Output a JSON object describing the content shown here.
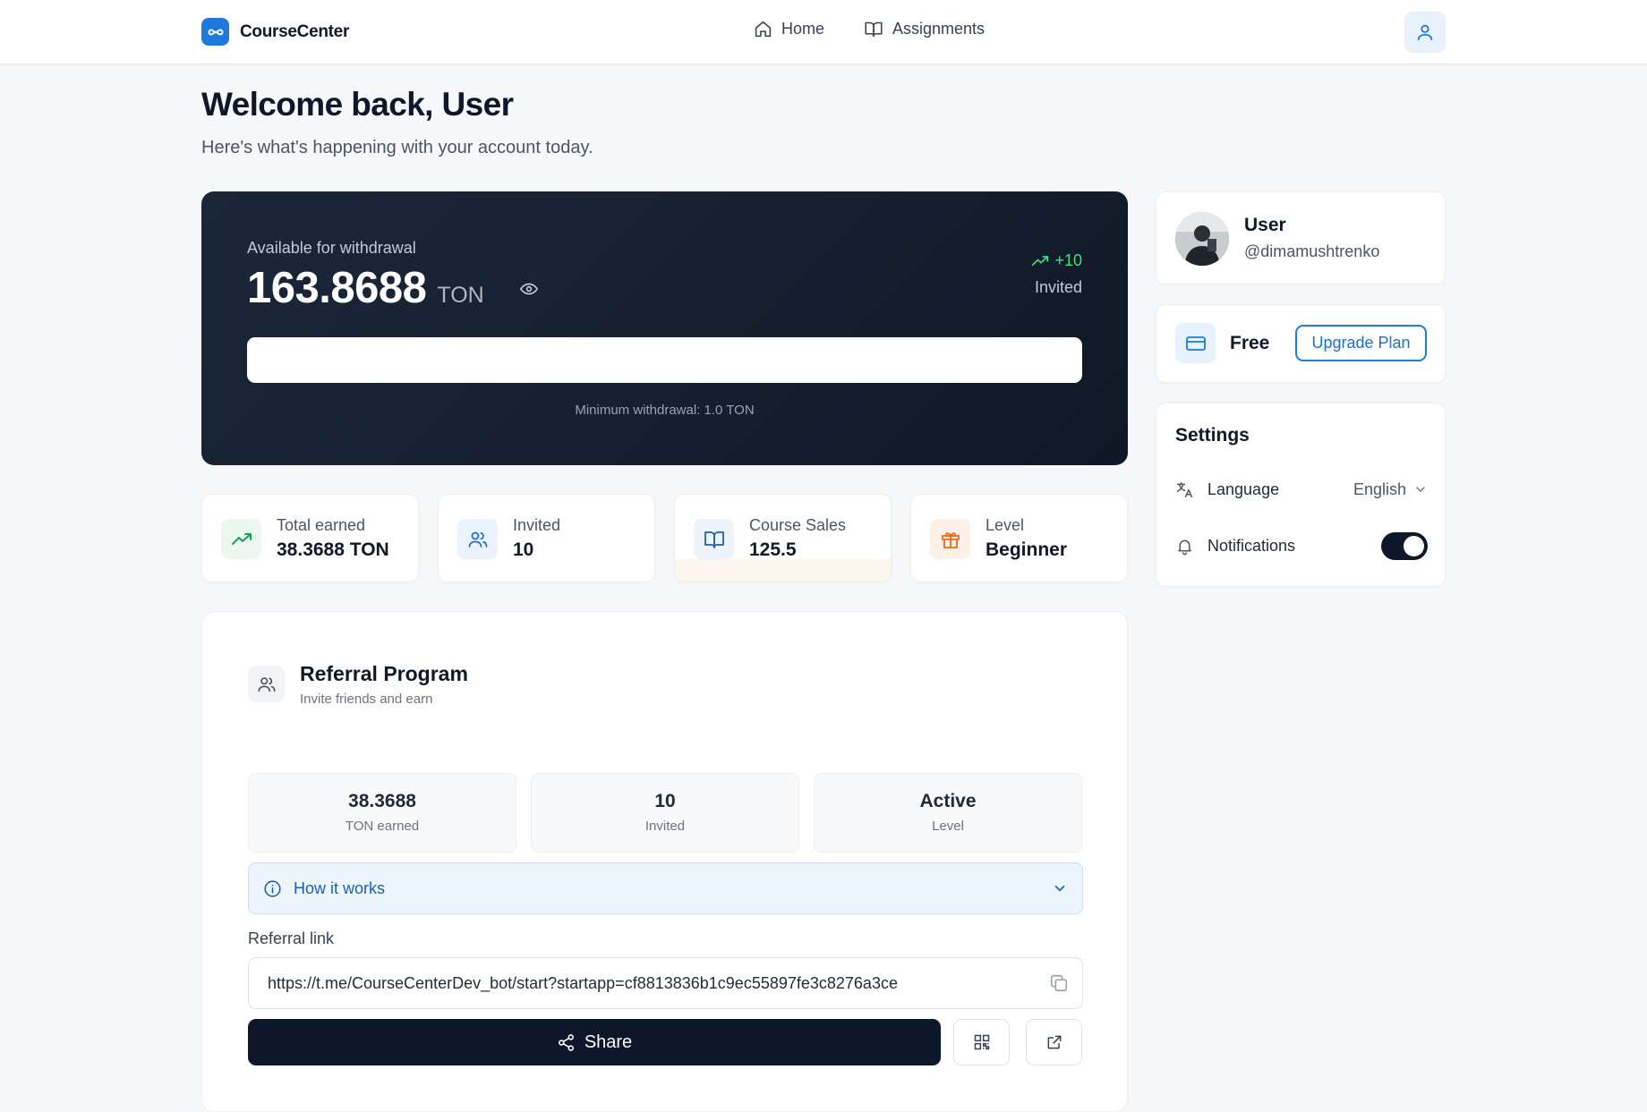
{
  "header": {
    "brand": "CourseCenter",
    "nav": [
      {
        "label": "Home",
        "icon": "home-icon"
      },
      {
        "label": "Assignments",
        "icon": "book-open-icon"
      }
    ],
    "user_icon": "user-icon"
  },
  "welcome": {
    "title": "Welcome back, User",
    "subtitle": "Here's what's happening with your account today."
  },
  "balance": {
    "label": "Available for withdrawal",
    "amount": "163.8688",
    "unit": "TON",
    "trend": "+10",
    "trend_label": "Invited",
    "min_note": "Minimum withdrawal: 1.0 TON"
  },
  "stats": [
    {
      "label": "Total earned",
      "value": "38.3688 TON",
      "icon": "trending-up-icon"
    },
    {
      "label": "Invited",
      "value": "10",
      "icon": "users-icon"
    },
    {
      "label": "Course Sales",
      "value": "125.5",
      "icon": "book-open-icon"
    },
    {
      "label": "Level",
      "value": "Beginner",
      "icon": "gift-icon"
    }
  ],
  "referral": {
    "title": "Referral Program",
    "subtitle": "Invite friends and earn",
    "stats": [
      {
        "value": "38.3688",
        "label": "TON earned"
      },
      {
        "value": "10",
        "label": "Invited"
      },
      {
        "value": "Active",
        "label": "Level"
      }
    ],
    "how_it_works": "How it works",
    "link_label": "Referral link",
    "link": "https://t.me/CourseCenterDev_bot/start?startapp=cf8813836b1c9ec55897fe3c8276a3ce",
    "share_label": "Share"
  },
  "profile": {
    "name": "User",
    "handle": "@dimamushtrenko"
  },
  "plan": {
    "name": "Free",
    "upgrade_label": "Upgrade Plan"
  },
  "settings": {
    "title": "Settings",
    "language_label": "Language",
    "language_value": "English",
    "notifications_label": "Notifications",
    "notifications_on": true
  },
  "colors": {
    "accent": "#1f7ae0",
    "dark": "#0f172a",
    "positive": "#4ade80"
  }
}
